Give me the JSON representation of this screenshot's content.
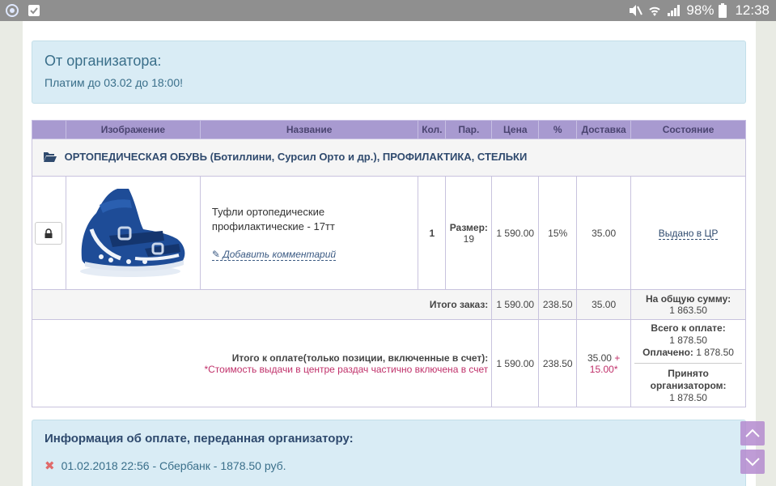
{
  "status_bar": {
    "battery": "98%",
    "time": "12:38"
  },
  "organizer": {
    "title": "От организатора:",
    "text": "Платим до 03.02 до 18:00!"
  },
  "table": {
    "headers": [
      "",
      "Изображение",
      "Название",
      "Кол.",
      "Пар.",
      "Цена",
      "%",
      "Доставка",
      "Состояние"
    ],
    "category": "ОРТОПЕДИЧЕСКАЯ ОБУВЬ (Ботиллини, Сурсил Орто и др.), ПРОФИЛАКТИКА, СТЕЛЬКИ",
    "item": {
      "name": "Туфли ортопедические профилактические - 17тт",
      "add_comment": "Добавить комментарий",
      "qty": "1",
      "param_label": "Размер:",
      "param_value": "19",
      "price": "1 590.00",
      "percent": "15%",
      "delivery": "35.00",
      "status": "Выдано в ЦР"
    },
    "order_total": {
      "label": "Итого заказ:",
      "price": "1 590.00",
      "percent": "238.50",
      "delivery": "35.00",
      "summary_label": "На общую сумму:",
      "summary_value": "1 863.50"
    },
    "pay_total": {
      "label": "Итого к оплате(только позиции, включенные в счет):",
      "note": "*Стоимость выдачи в центре раздач частично включена в счет",
      "price": "1 590.00",
      "percent": "238.50",
      "delivery": "35.00",
      "delivery_extra": "+ 15.00*",
      "due_label": "Всего к оплате:",
      "due_value": "1 878.50",
      "paid_label": "Оплачено:",
      "paid_value": "1 878.50",
      "accepted_label": "Принято организатором:",
      "accepted_value": "1 878.50"
    }
  },
  "payment_info": {
    "title": "Информация об оплате, переданная организатору:",
    "items": [
      "01.02.2018 22:56 - Сбербанк - 1878.50 руб."
    ]
  },
  "colors": {
    "header_bg": "#a89ad0",
    "info_bg": "#d9ecf5",
    "accent_red": "#c0306a",
    "scroll_btn": "#b58bd0"
  }
}
